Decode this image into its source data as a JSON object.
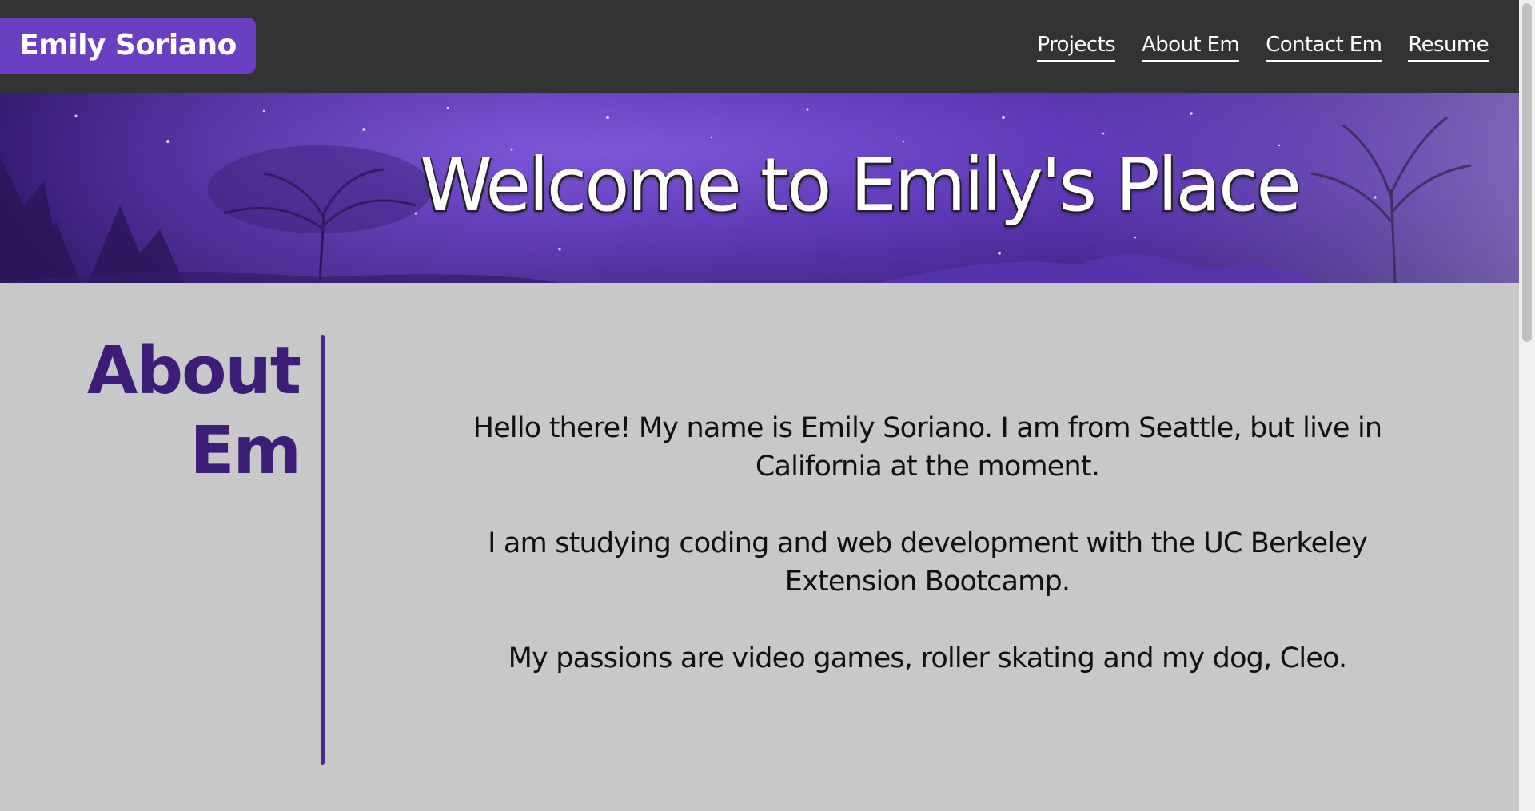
{
  "header": {
    "brand": "Emily Soriano",
    "nav": [
      "Projects",
      "About Em",
      "Contact Em",
      "Resume"
    ]
  },
  "hero": {
    "title": "Welcome to Emily's Place"
  },
  "about": {
    "heading_line1": "About",
    "heading_line2": "Em",
    "paragraphs": [
      "Hello there! My name is Emily Soriano. I am from Seattle, but live in California at the moment.",
      "I am studying coding and web development with the UC Berkeley Extension Bootcamp.",
      "My passions are video games, roller skating and my dog, Cleo."
    ]
  },
  "colors": {
    "header_bg": "#333333",
    "brand_bg": "#6a3fc2",
    "accent": "#3d1d78",
    "page_bg": "#c8c8c8"
  }
}
